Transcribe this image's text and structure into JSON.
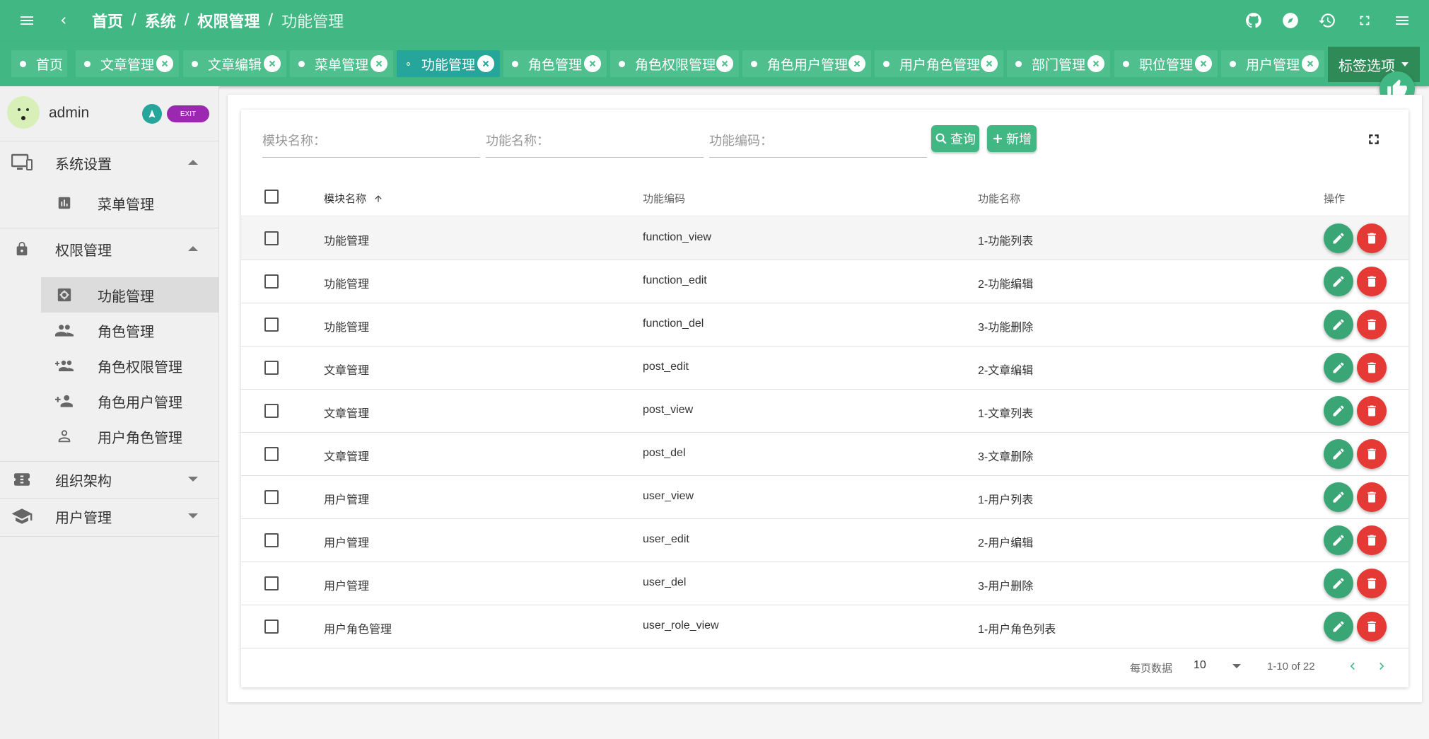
{
  "header": {
    "breadcrumb": [
      "首页",
      "系统",
      "权限管理",
      "功能管理"
    ]
  },
  "tabs": [
    {
      "label": "首页",
      "closable": false,
      "active": false
    },
    {
      "label": "文章管理",
      "closable": true,
      "active": false
    },
    {
      "label": "文章编辑",
      "closable": true,
      "active": false
    },
    {
      "label": "菜单管理",
      "closable": true,
      "active": false
    },
    {
      "label": "功能管理",
      "closable": true,
      "active": true
    },
    {
      "label": "角色管理",
      "closable": true,
      "active": false
    },
    {
      "label": "角色权限管理",
      "closable": true,
      "active": false
    },
    {
      "label": "角色用户管理",
      "closable": true,
      "active": false
    },
    {
      "label": "用户角色管理",
      "closable": true,
      "active": false
    },
    {
      "label": "部门管理",
      "closable": true,
      "active": false
    },
    {
      "label": "职位管理",
      "closable": true,
      "active": false
    },
    {
      "label": "用户管理",
      "closable": true,
      "active": false
    }
  ],
  "tab_options_label": "标签选项",
  "user": {
    "name": "admin",
    "exit_label": "EXIT"
  },
  "sidebar": {
    "groups": [
      {
        "label": "系统设置",
        "icon": "monitor-settings-icon",
        "expanded": true
      },
      {
        "label": "权限管理",
        "icon": "lock-icon",
        "expanded": true
      },
      {
        "label": "组织架构",
        "icon": "ticket-icon",
        "expanded": false
      },
      {
        "label": "用户管理",
        "icon": "school-icon",
        "expanded": false
      }
    ],
    "items": [
      {
        "label": "菜单管理",
        "icon": "chart-icon"
      },
      {
        "label": "功能管理",
        "icon": "gear-icon",
        "active": true
      },
      {
        "label": "角色管理",
        "icon": "people-icon"
      },
      {
        "label": "角色权限管理",
        "icon": "group-add-icon"
      },
      {
        "label": "角色用户管理",
        "icon": "person-add-icon"
      },
      {
        "label": "用户角色管理",
        "icon": "person-icon"
      }
    ]
  },
  "search": {
    "module_placeholder": "模块名称：",
    "name_placeholder": "功能名称：",
    "code_placeholder": "功能编码：",
    "query_label": "查询",
    "add_label": "新增"
  },
  "table": {
    "headers": {
      "module": "模块名称",
      "code": "功能编码",
      "name": "功能名称",
      "actions": "操作"
    },
    "rows": [
      {
        "module": "功能管理",
        "code": "function_view",
        "name": "1-功能列表"
      },
      {
        "module": "功能管理",
        "code": "function_edit",
        "name": "2-功能编辑"
      },
      {
        "module": "功能管理",
        "code": "function_del",
        "name": "3-功能删除"
      },
      {
        "module": "文章管理",
        "code": "post_edit",
        "name": "2-文章编辑"
      },
      {
        "module": "文章管理",
        "code": "post_view",
        "name": "1-文章列表"
      },
      {
        "module": "文章管理",
        "code": "post_del",
        "name": "3-文章删除"
      },
      {
        "module": "用户管理",
        "code": "user_view",
        "name": "1-用户列表"
      },
      {
        "module": "用户管理",
        "code": "user_edit",
        "name": "2-用户编辑"
      },
      {
        "module": "用户管理",
        "code": "user_del",
        "name": "3-用户删除"
      },
      {
        "module": "用户角色管理",
        "code": "user_role_view",
        "name": "1-用户角色列表"
      }
    ]
  },
  "pagination": {
    "per_page_label": "每页数据",
    "per_page": "10",
    "range": "1-10 of 22"
  },
  "colors": {
    "primary": "#41b883",
    "active_tab": "#26a69a",
    "delete": "#e53935",
    "exit": "#9c27b0"
  }
}
